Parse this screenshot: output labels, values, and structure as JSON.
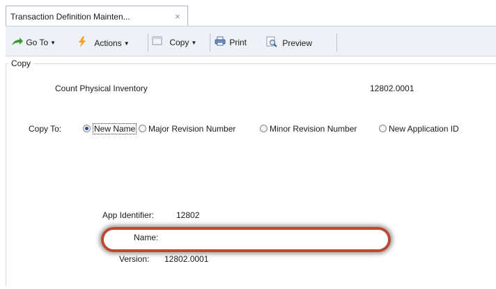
{
  "tab": {
    "title": "Transaction Definition Mainten...",
    "close": "×"
  },
  "toolbar": {
    "goto_label": "Go To",
    "actions_label": "Actions",
    "copy_label": "Copy",
    "print_label": "Print",
    "preview_label": "Preview",
    "icons": [
      "goto-arrow-icon",
      "actions-lightning-icon",
      "copy-document-icon",
      "printer-icon",
      "preview-magnifier-icon"
    ]
  },
  "copy_section": {
    "legend": "Copy",
    "source_name": "Count Physical Inventory",
    "source_version": "12802.0001",
    "copy_to_label": "Copy To:",
    "options": [
      {
        "label": "New Name",
        "selected": true
      },
      {
        "label": "Major Revision Number",
        "selected": false
      },
      {
        "label": "Minor Revision Number",
        "selected": false
      },
      {
        "label": "New Application ID",
        "selected": false
      }
    ],
    "app_identifier_label": "App Identifier:",
    "app_identifier_value": "12802",
    "name_label": "Name:",
    "name_value": "",
    "version_label": "Version:",
    "version_value": "12802.0001"
  },
  "colors": {
    "toolbar_bg": "#eef1f5",
    "tab_border": "#a9b4c4",
    "highlight_ring": "#b84a34",
    "radio_selected": "#2c4a8c"
  }
}
